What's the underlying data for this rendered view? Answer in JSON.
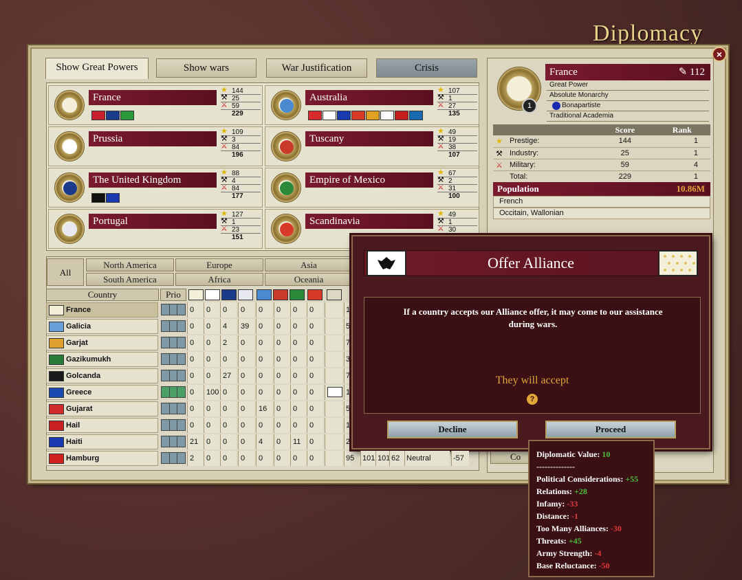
{
  "screen_title": "Diplomacy",
  "close_label": "×",
  "tabs": [
    "Show Great Powers",
    "Show wars",
    "War Justification",
    "Crisis"
  ],
  "great_powers": [
    {
      "name": "France",
      "prestige": "144",
      "industry": "25",
      "military": "59",
      "total": "229",
      "flag": "#f4efd8"
    },
    {
      "name": "Australia",
      "prestige": "107",
      "industry": "1",
      "military": "27",
      "total": "135",
      "flag": "#4a8ad0"
    },
    {
      "name": "Prussia",
      "prestige": "109",
      "industry": "3",
      "military": "84",
      "total": "196",
      "flag": "#ffffff"
    },
    {
      "name": "Tuscany",
      "prestige": "49",
      "industry": "19",
      "military": "38",
      "total": "107",
      "flag": "#c83a2a"
    },
    {
      "name": "The United Kingdom",
      "prestige": "88",
      "industry": "4",
      "military": "84",
      "total": "177",
      "flag": "#1a3a8a"
    },
    {
      "name": "Empire of Mexico",
      "prestige": "67",
      "industry": "2",
      "military": "31",
      "total": "100",
      "flag": "#2a8a3a"
    },
    {
      "name": "Portugal",
      "prestige": "127",
      "industry": "1",
      "military": "23",
      "total": "151",
      "flag": "#e8e8f0"
    },
    {
      "name": "Scandinavia",
      "prestige": "49",
      "industry": "1",
      "military": "30",
      "total": "",
      "flag": "#d83a2a"
    }
  ],
  "regions": {
    "all": "All",
    "items": [
      "North America",
      "Europe",
      "Asia",
      "South America",
      "Africa",
      "Oceania"
    ]
  },
  "table_headers": {
    "country": "Country",
    "prio": "Prio"
  },
  "rows": [
    {
      "name": "France",
      "vals": [
        "0",
        "0",
        "0",
        "0",
        "0",
        "0",
        "0",
        "0"
      ],
      "extra": "1",
      "flag": "#f4efd8",
      "sel": true,
      "prio": "b"
    },
    {
      "name": "Galicia",
      "vals": [
        "0",
        "0",
        "4",
        "39",
        "0",
        "0",
        "0",
        "0"
      ],
      "extra": "5",
      "flag": "#6aa0d8",
      "prio": "b"
    },
    {
      "name": "Garjat",
      "vals": [
        "0",
        "0",
        "2",
        "0",
        "0",
        "0",
        "0",
        "0"
      ],
      "extra": "7",
      "flag": "#e0a030",
      "prio": "b"
    },
    {
      "name": "Gazikumukh",
      "vals": [
        "0",
        "0",
        "0",
        "0",
        "0",
        "0",
        "0",
        "0"
      ],
      "extra": "3",
      "flag": "#2a7a3a",
      "prio": "b"
    },
    {
      "name": "Golcanda",
      "vals": [
        "0",
        "0",
        "27",
        "0",
        "0",
        "0",
        "0",
        "0"
      ],
      "extra": "7",
      "flag": "#1a1a1a",
      "prio": "b"
    },
    {
      "name": "Greece",
      "vals": [
        "0",
        "100",
        "0",
        "0",
        "0",
        "0",
        "0",
        "0"
      ],
      "extra": "1",
      "flag": "#1a4ab0",
      "prio": "g"
    },
    {
      "name": "Gujarat",
      "vals": [
        "0",
        "0",
        "0",
        "0",
        "16",
        "0",
        "0",
        "0"
      ],
      "extra": "5",
      "flag": "#d02a2a",
      "prio": "b"
    },
    {
      "name": "Hail",
      "vals": [
        "0",
        "0",
        "0",
        "0",
        "0",
        "0",
        "0",
        "0"
      ],
      "extra": "1",
      "flag": "#c82020",
      "prio": "b"
    },
    {
      "name": "Haiti",
      "vals": [
        "21",
        "0",
        "0",
        "0",
        "4",
        "0",
        "11",
        "0"
      ],
      "extra": "2",
      "flag": "#1a3ab0",
      "prio": "b"
    },
    {
      "name": "Hamburg",
      "vals": [
        "2",
        "0",
        "0",
        "0",
        "0",
        "0",
        "0",
        "0"
      ],
      "extra": "95",
      "flag": "#d02020",
      "prio": "b",
      "tail": [
        "101",
        "101",
        "62",
        "Neutral",
        "-57"
      ]
    }
  ],
  "selected_country": {
    "name": "France",
    "influence": "112",
    "rank": "1",
    "details": [
      "Great Power",
      "Absolute Monarchy",
      "Bonapartiste",
      "Traditional Academia"
    ],
    "score_headers": [
      "Score",
      "Rank"
    ],
    "scores": [
      {
        "label": "Prestige:",
        "score": "144",
        "rank": "1"
      },
      {
        "label": "Industry:",
        "score": "25",
        "rank": "1"
      },
      {
        "label": "Military:",
        "score": "59",
        "rank": "4"
      },
      {
        "label": "Total:",
        "score": "229",
        "rank": "1"
      }
    ],
    "population_label": "Population",
    "population_value": "10.86M",
    "cultures": [
      "French",
      "Occitain, Wallonian"
    ]
  },
  "dialog": {
    "title": "Offer Alliance",
    "description": "If a country accepts our Alliance offer, it may come to our assistance during wars.",
    "verdict": "They will accept",
    "help": "?",
    "decline": "Decline",
    "proceed": "Proceed"
  },
  "tooltip": {
    "header_label": "Diplomatic Value:",
    "header_value": "10",
    "separator": "--------------",
    "items": [
      {
        "label": "Political Considerations:",
        "value": "+55",
        "sign": "pos"
      },
      {
        "label": "Relations:",
        "value": "+28",
        "sign": "pos"
      },
      {
        "label": "Infamy:",
        "value": "-33",
        "sign": "neg"
      },
      {
        "label": "Distance:",
        "value": "-1",
        "sign": "neg"
      },
      {
        "label": "Too Many Alliances:",
        "value": "-30",
        "sign": "neg"
      },
      {
        "label": "Threats:",
        "value": "+45",
        "sign": "pos"
      },
      {
        "label": "Army Strength:",
        "value": "-4",
        "sign": "neg"
      },
      {
        "label": "Base Reluctance:",
        "value": "-50",
        "sign": "neg"
      }
    ]
  },
  "partial_button": "Co"
}
